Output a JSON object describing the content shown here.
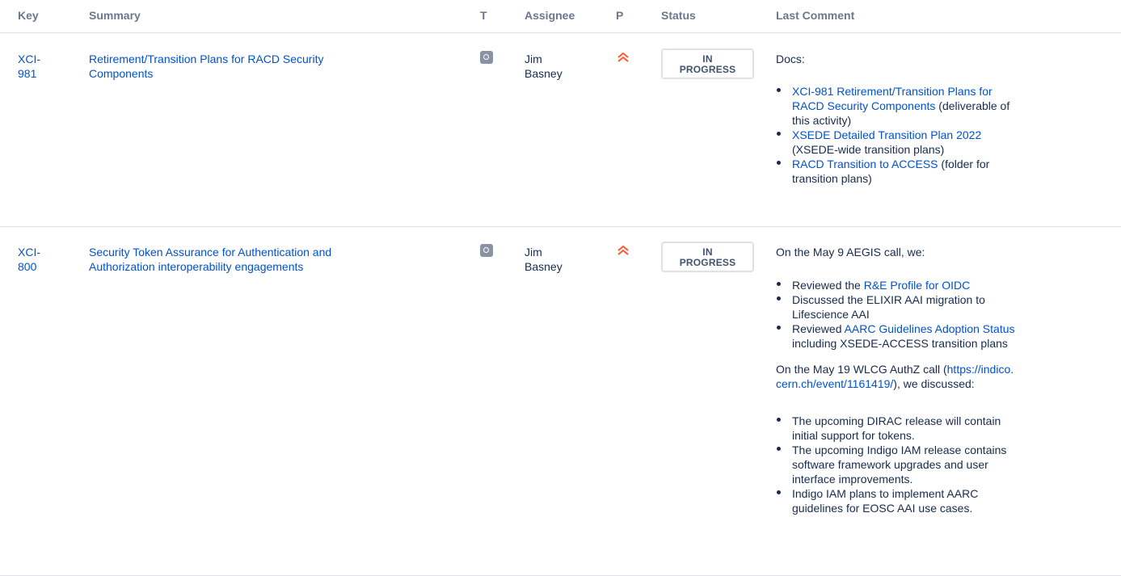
{
  "headers": {
    "key": "Key",
    "summary": "Summary",
    "type": "T",
    "assignee": "Assignee",
    "priority": "P",
    "status": "Status",
    "last_comment": "Last Comment"
  },
  "rows": [
    {
      "key_line1": "XCI-",
      "key_line2": "981",
      "summary_line1": "Retirement/Transition Plans for RACD Security",
      "summary_line2": "Components",
      "type_icon": "task-icon",
      "assignee_line1": "Jim",
      "assignee_line2": "Basney",
      "priority_icon": "highest-priority-icon",
      "status_line1": "IN",
      "status_line2": "PROGRESS",
      "comment": {
        "intro": "Docs:",
        "items": [
          {
            "link_lines": [
              "XCI-981 Retirement/Transition Plans for",
              "RACD Security Components"
            ],
            "text_after": " (deliverable of",
            "text_lines": [
              "this activity)"
            ]
          },
          {
            "link_lines": [
              "XSEDE Detailed Transition Plan 2022"
            ],
            "text_lines": [
              "(XSEDE-wide transition plans)"
            ]
          },
          {
            "link_lines": [
              "RACD Transition to ACCESS"
            ],
            "text_after": " (folder for",
            "text_lines": [
              "transition plans)"
            ]
          }
        ]
      }
    },
    {
      "key_line1": "XCI-",
      "key_line2": "800",
      "summary_line1": "Security Token Assurance for Authentication and",
      "summary_line2": "Authorization interoperability engagements",
      "type_icon": "task-icon",
      "assignee_line1": "Jim",
      "assignee_line2": "Basney",
      "priority_icon": "highest-priority-icon",
      "status_line1": "IN",
      "status_line2": "PROGRESS",
      "comment": {
        "intro": "On the May 9 AEGIS call, we:",
        "items1": [
          {
            "before": "Reviewed the ",
            "link": "R&E Profile for OIDC"
          },
          {
            "lines": [
              "Discussed the ELIXIR AAI migration to",
              "Lifescience AAI"
            ]
          },
          {
            "before": "Reviewed ",
            "link": "AARC Guidelines Adoption Status",
            "after_lines": [
              "including XSEDE-ACCESS transition plans"
            ]
          }
        ],
        "para2_before": "On the May 19 WLCG AuthZ call (",
        "para2_link_line1": "https://indico.",
        "para2_link_line2": "cern.ch/event/1161419/",
        "para2_after": "), we discussed:",
        "items2": [
          [
            "The upcoming DIRAC release will contain",
            "initial support for tokens."
          ],
          [
            "The upcoming Indigo IAM release contains",
            "software framework upgrades and user",
            "interface improvements."
          ],
          [
            "Indigo IAM plans to implement AARC",
            "guidelines for EOSC AAI use cases."
          ]
        ]
      }
    }
  ],
  "colors": {
    "link": "#0052cc",
    "header_text": "#6b778c",
    "priority": "#ff5630",
    "type_icon": "#8993a4"
  }
}
